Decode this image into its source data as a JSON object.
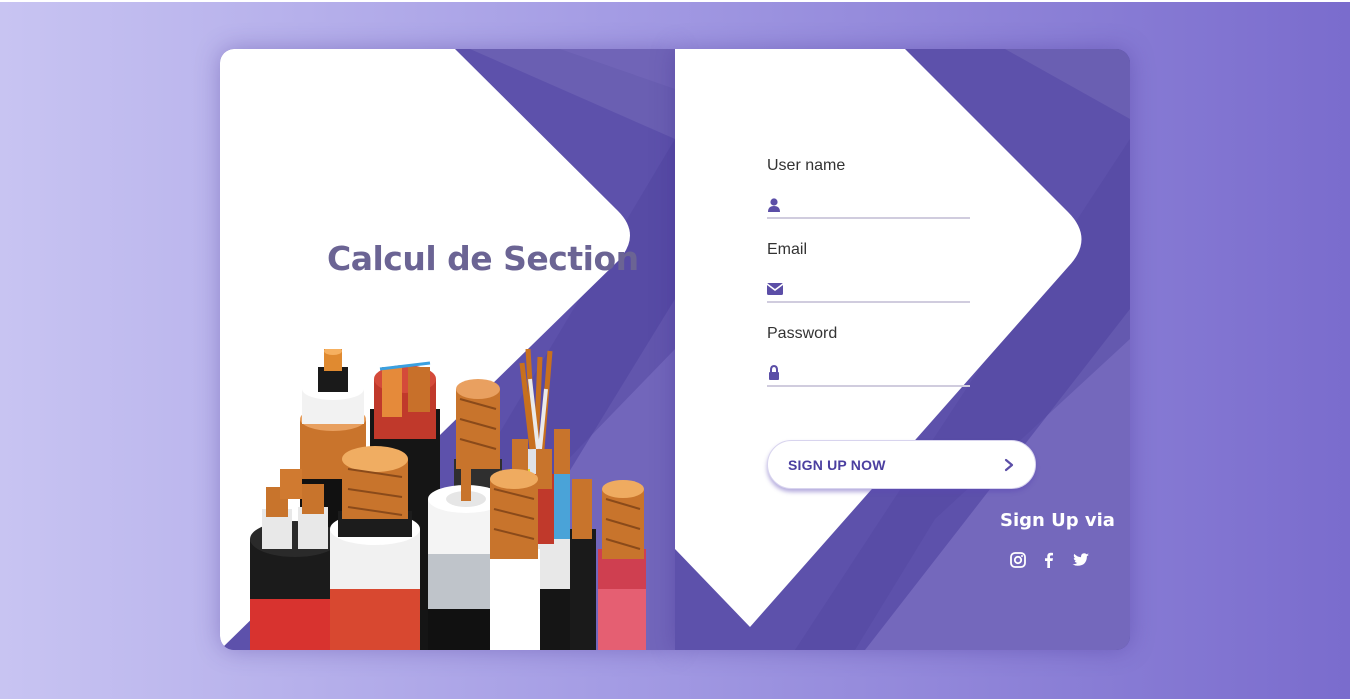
{
  "branding": {
    "title": "Calcul de Section",
    "illustration": "electrical-cables-image"
  },
  "form": {
    "username": {
      "label": "User name",
      "icon": "user-icon",
      "value": ""
    },
    "email": {
      "label": "Email",
      "icon": "envelope-icon",
      "value": ""
    },
    "password": {
      "label": "Password",
      "icon": "lock-icon",
      "value": ""
    },
    "submit_label": "SIGN UP NOW",
    "submit_icon": "chevron-right-icon"
  },
  "social": {
    "heading": "Sign Up via",
    "networks": [
      "instagram-icon",
      "facebook-icon",
      "twitter-icon"
    ]
  },
  "colors": {
    "accent": "#5b4ea7",
    "title": "#6b6494",
    "button_text": "#4b3fa0"
  }
}
